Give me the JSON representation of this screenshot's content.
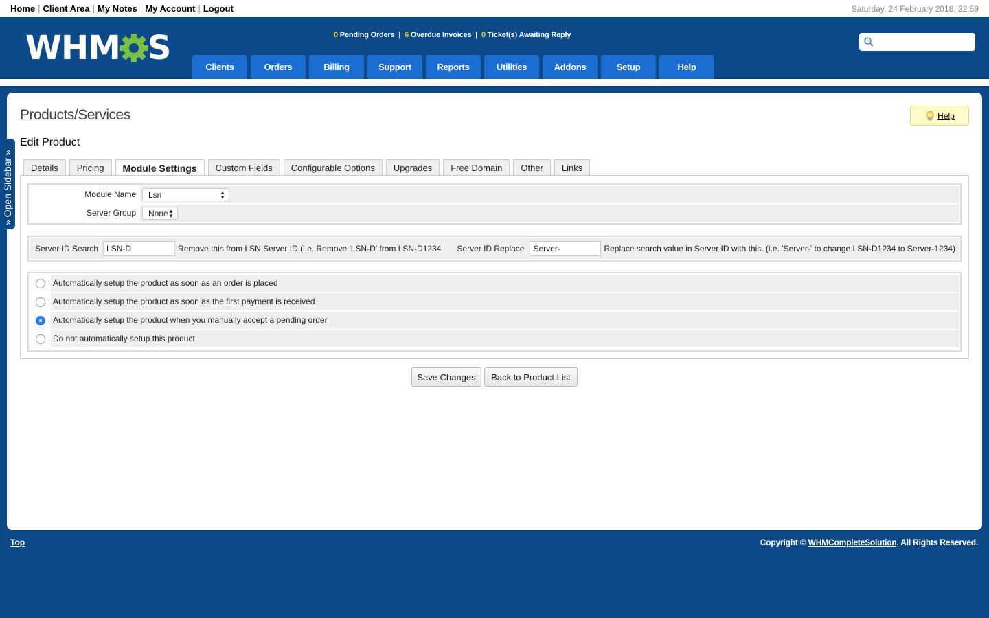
{
  "toplinks": {
    "home": "Home",
    "client_area": "Client Area",
    "my_notes": "My Notes",
    "my_account": "My Account",
    "logout": "Logout",
    "separator": "|"
  },
  "datetime": "Saturday, 24 February 2018, 22:59",
  "logo": {
    "left": "WHM",
    "right": "S"
  },
  "stats": {
    "pending_orders_count": "0",
    "pending_orders_label": "Pending Orders",
    "overdue_count": "6",
    "overdue_label": "Overdue Invoices",
    "tickets_count": "0",
    "tickets_label": "Ticket(s) Awaiting Reply",
    "separator": "|"
  },
  "nav": [
    "Clients",
    "Orders",
    "Billing",
    "Support",
    "Reports",
    "Utilities",
    "Addons",
    "Setup",
    "Help"
  ],
  "page": {
    "title": "Products/Services",
    "subtitle": "Edit Product",
    "help_label": "Help"
  },
  "tabs": [
    "Details",
    "Pricing",
    "Module Settings",
    "Custom Fields",
    "Configurable Options",
    "Upgrades",
    "Free Domain",
    "Other",
    "Links"
  ],
  "active_tab": "Module Settings",
  "module": {
    "module_name_label": "Module Name",
    "module_name_value": "Lsn",
    "server_group_label": "Server Group",
    "server_group_value": "None"
  },
  "server_id": {
    "search_label": "Server ID Search",
    "search_value": "LSN-D",
    "search_help": "Remove this from LSN Server ID (i.e. Remove 'LSN-D' from LSN-D1234",
    "replace_label": "Server ID Replace",
    "replace_value": "Server-",
    "replace_help": "Replace search value in Server ID with this. (i.e. 'Server-' to change LSN-D1234 to Server-1234)"
  },
  "setup_options": [
    {
      "label": "Automatically setup the product as soon as an order is placed",
      "checked": false
    },
    {
      "label": "Automatically setup the product as soon as the first payment is received",
      "checked": false
    },
    {
      "label": "Automatically setup the product when you manually accept a pending order",
      "checked": true
    },
    {
      "label": "Do not automatically setup this product",
      "checked": false
    }
  ],
  "buttons": {
    "save": "Save Changes",
    "back": "Back to Product List"
  },
  "sidebar_toggle": "» Open Sidebar »",
  "footer": {
    "top": "Top",
    "copyright_prefix": "Copyright ©",
    "copyright_link": "WHMCompleteSolution",
    "copyright_suffix": ". All Rights Reserved."
  },
  "colors": {
    "brand_blue": "#0e4a89",
    "nav_blue": "#1a6ed2",
    "stat_yellow": "#ffcc00",
    "radio_selected": "#2b7cf0"
  }
}
